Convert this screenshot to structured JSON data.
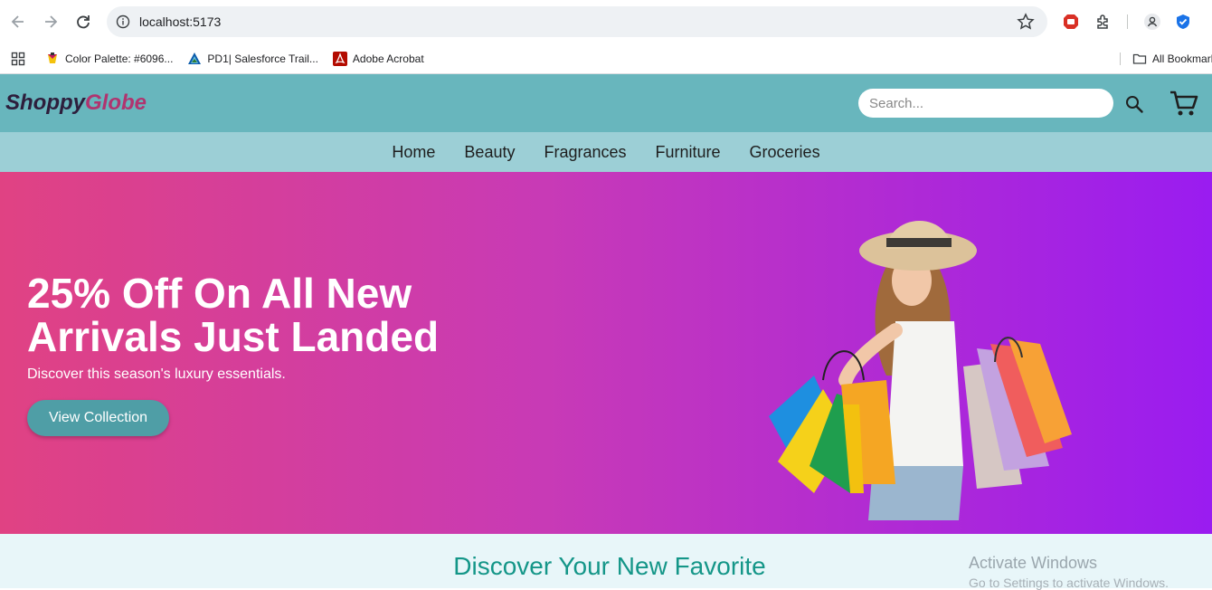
{
  "browser": {
    "url": "localhost:5173",
    "bookmarks": [
      {
        "label": "Color Palette: #6096...",
        "icon": "palette-icon"
      },
      {
        "label": "PD1| Salesforce Trail...",
        "icon": "trailhead-icon"
      },
      {
        "label": "Adobe Acrobat",
        "icon": "acrobat-icon"
      }
    ],
    "all_bookmarks": "All Bookmarks"
  },
  "site": {
    "logo_part1": "Shoppy",
    "logo_part2": "Globe",
    "search_placeholder": "Search...",
    "nav": [
      "Home",
      "Beauty",
      "Fragrances",
      "Furniture",
      "Groceries"
    ]
  },
  "hero": {
    "headline": "25% Off On All New Arrivals Just Landed",
    "subtext": "Discover this season's luxury essentials.",
    "cta": "View Collection"
  },
  "section": {
    "title": "Discover Your New Favorite"
  },
  "watermark": {
    "line1": "Activate Windows",
    "line2": "Go to Settings to activate Windows."
  },
  "colors": {
    "header": "#68b6bd",
    "nav": "#9ccfd6",
    "hero_start": "#e04283",
    "hero_end": "#9a1cf0",
    "cta": "#4f9ea6",
    "section_title": "#149688"
  }
}
